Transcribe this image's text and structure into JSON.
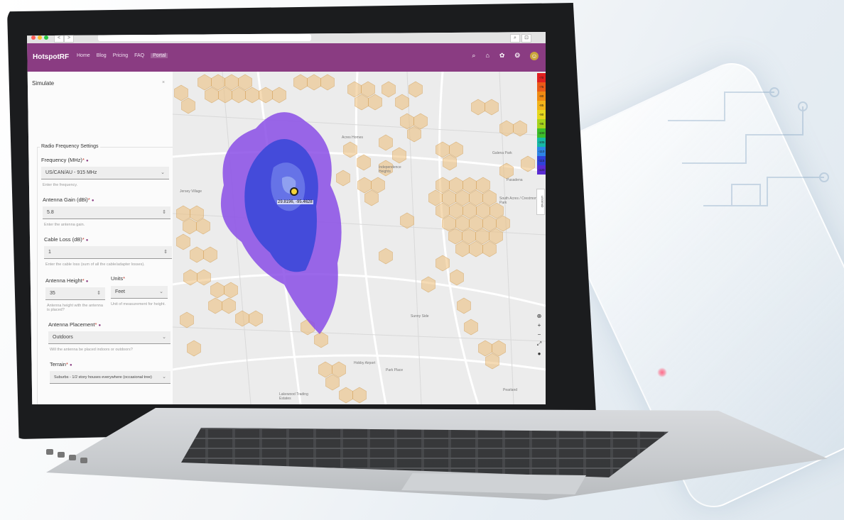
{
  "browser": {
    "back": "<",
    "forward": ">",
    "actions": [
      "⌕",
      "⊡"
    ]
  },
  "app": {
    "brand": "HotspotRF",
    "nav": [
      {
        "label": "Home"
      },
      {
        "label": "Blog"
      },
      {
        "label": "Pricing"
      },
      {
        "label": "FAQ"
      },
      {
        "label": "Portal",
        "active": true
      }
    ],
    "header_icons": [
      "search-icon",
      "home-icon",
      "settings-icon",
      "help-icon",
      "avatar"
    ],
    "accent_color": "#8a3c82"
  },
  "sidebar": {
    "title": "Simulate",
    "close": "×",
    "section": "Radio Frequency Settings",
    "frequency": {
      "label": "Frequency (MHz)",
      "value": "US/CAN/AU - 915 MHz",
      "helper": "Enter the frequency."
    },
    "antenna_gain": {
      "label": "Antenna Gain (dBi)",
      "value": "5.8",
      "helper": "Enter the antenna gain."
    },
    "cable_loss": {
      "label": "Cable Loss (dB)",
      "value": "1",
      "helper": "Enter the cable loss (sum of all the cable/adapter losses)."
    },
    "antenna_height": {
      "label": "Antenna Height",
      "value": "35",
      "helper": "Antenna height with the antenna is placed?"
    },
    "units": {
      "label": "Units",
      "value": "Feet",
      "helper": "Unit of measurement for height."
    },
    "antenna_placement": {
      "label": "Antenna Placement",
      "value": "Outdoors",
      "helper": "Will the antenna be placed indoors or outdoors?"
    },
    "terrain": {
      "label": "Terrain",
      "value": "Suburbs - 1/2 story houses everywhere (occasional tree)"
    }
  },
  "map": {
    "coordinate_label": "29.8196, -95.4628",
    "labels": [
      "Jersey Village",
      "Acres Homes",
      "Independence Heights",
      "Galena Park",
      "South Acres / Crestmont Park",
      "Hobby Airport",
      "Lakewood Trading Estates",
      "Pearland",
      "Sunny Side",
      "Park Place",
      "Pasadena"
    ],
    "signal_scale": [
      "-70",
      "-75",
      "-80",
      "-85",
      "-90",
      "-95",
      "-100",
      "-105",
      "-110",
      "-115",
      "-120"
    ],
    "signal_colors": [
      "#e02020",
      "#ea5a18",
      "#f08a12",
      "#f3b31a",
      "#e6d81d",
      "#a6d31b",
      "#3dbd2b",
      "#16b8a5",
      "#2d85e6",
      "#3042d8",
      "#5a2bd2"
    ],
    "legend_tab": "LEGEND",
    "zoom_controls": [
      "⊕",
      "+",
      "−",
      "⤢",
      "●"
    ]
  }
}
